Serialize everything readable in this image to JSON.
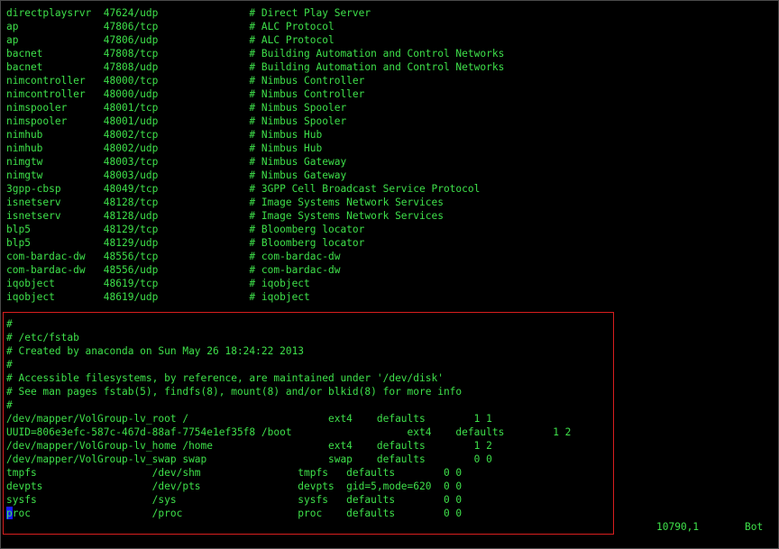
{
  "colors": {
    "background": "#000000",
    "text": "#3ee04a",
    "cursor": "#1a1aff",
    "highlight_border": "#d81e1e"
  },
  "services_lines": [
    "directplaysrvr  47624/udp               # Direct Play Server",
    "ap              47806/tcp               # ALC Protocol",
    "ap              47806/udp               # ALC Protocol",
    "bacnet          47808/tcp               # Building Automation and Control Networks",
    "bacnet          47808/udp               # Building Automation and Control Networks",
    "nimcontroller   48000/tcp               # Nimbus Controller",
    "nimcontroller   48000/udp               # Nimbus Controller",
    "nimspooler      48001/tcp               # Nimbus Spooler",
    "nimspooler      48001/udp               # Nimbus Spooler",
    "nimhub          48002/tcp               # Nimbus Hub",
    "nimhub          48002/udp               # Nimbus Hub",
    "nimgtw          48003/tcp               # Nimbus Gateway",
    "nimgtw          48003/udp               # Nimbus Gateway",
    "3gpp-cbsp       48049/tcp               # 3GPP Cell Broadcast Service Protocol",
    "isnetserv       48128/tcp               # Image Systems Network Services",
    "isnetserv       48128/udp               # Image Systems Network Services",
    "blp5            48129/tcp               # Bloomberg locator",
    "blp5            48129/udp               # Bloomberg locator",
    "com-bardac-dw   48556/tcp               # com-bardac-dw",
    "com-bardac-dw   48556/udp               # com-bardac-dw",
    "iqobject        48619/tcp               # iqobject",
    "iqobject        48619/udp               # iqobject"
  ],
  "fstab_lines": [
    "#",
    "# /etc/fstab",
    "# Created by anaconda on Sun May 26 18:24:22 2013",
    "#",
    "# Accessible filesystems, by reference, are maintained under '/dev/disk'",
    "# See man pages fstab(5), findfs(8), mount(8) and/or blkid(8) for more info",
    "#",
    "/dev/mapper/VolGroup-lv_root /                       ext4    defaults        1 1",
    "UUID=806e3efc-587c-467d-88af-7754e1ef35f8 /boot                   ext4    defaults        1 2",
    "/dev/mapper/VolGroup-lv_home /home                   ext4    defaults        1 2",
    "/dev/mapper/VolGroup-lv_swap swap                    swap    defaults        0 0",
    "tmpfs                   /dev/shm                tmpfs   defaults        0 0",
    "devpts                  /dev/pts                devpts  gid=5,mode=620  0 0",
    "sysfs                   /sys                    sysfs   defaults        0 0",
    "proc                    /proc                   proc    defaults        0 0"
  ],
  "status": {
    "position": "10790,1",
    "scroll": "Bot"
  }
}
